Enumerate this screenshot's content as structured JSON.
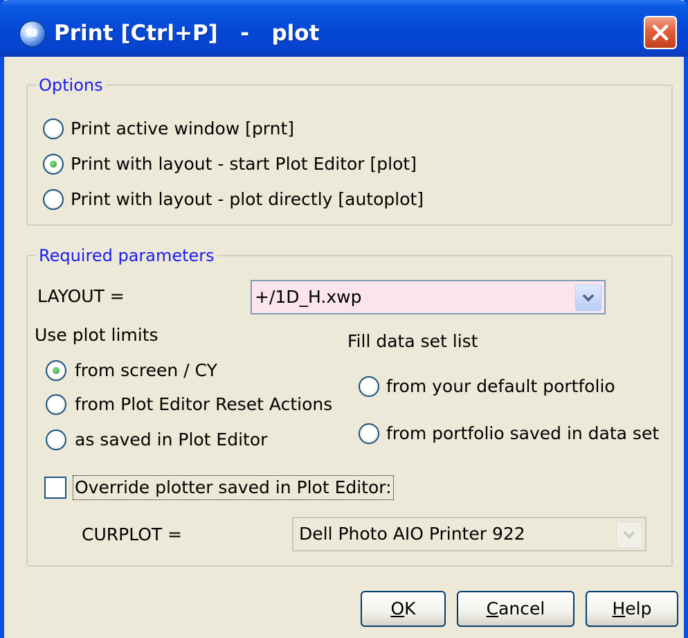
{
  "window": {
    "title": "Print [Ctrl+P]   -   plot",
    "close_icon": "close-icon"
  },
  "options": {
    "legend": "Options",
    "radios": [
      {
        "label": "Print active window [prnt]",
        "selected": false
      },
      {
        "label": "Print with layout - start Plot Editor [plot]",
        "selected": true
      },
      {
        "label": "Print with layout - plot directly [autoplot]",
        "selected": false
      }
    ]
  },
  "params": {
    "legend": "Required parameters",
    "layout_label": "LAYOUT =",
    "layout_value": "+/1D_H.xwp",
    "plot_limits_label": "Use plot limits",
    "plot_limits_options": [
      {
        "label": "from screen / CY",
        "selected": true
      },
      {
        "label": "from Plot Editor Reset Actions",
        "selected": false
      },
      {
        "label": "as saved in Plot Editor",
        "selected": false
      }
    ],
    "fill_label": "Fill data set list",
    "fill_options": [
      {
        "label": "from your default portfolio",
        "selected": false
      },
      {
        "label": "from portfolio saved in data set",
        "selected": false
      }
    ],
    "override_label": "Override plotter saved in Plot Editor:",
    "override_checked": false,
    "curplot_label": "CURPLOT =",
    "curplot_value": "Dell Photo AIO Printer 922"
  },
  "buttons": {
    "ok": {
      "mnemonic": "O",
      "rest": "K"
    },
    "cancel": {
      "mnemonic": "C",
      "rest": "ancel"
    },
    "help": {
      "mnemonic": "H",
      "rest": "elp"
    }
  },
  "colors": {
    "title_bar": "#0648d6",
    "legend_text": "#1c1cf0",
    "layout_field_bg": "#fbe4ec",
    "dialog_bg": "#ece9d8",
    "close_button": "#e0603c"
  }
}
